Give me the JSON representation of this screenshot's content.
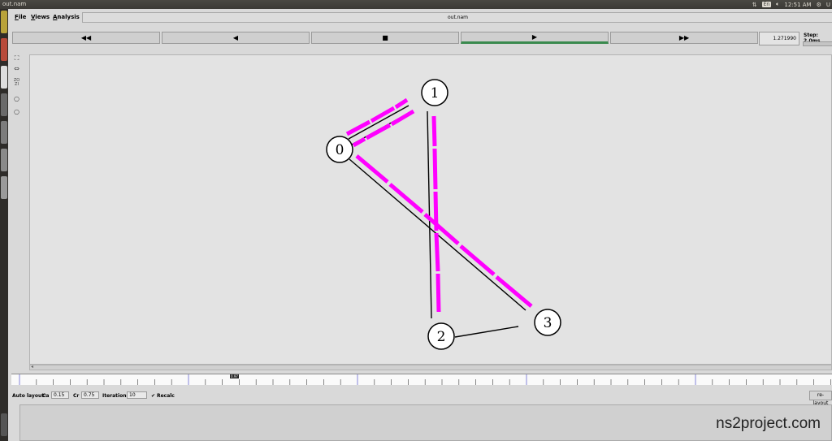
{
  "topbar": {
    "window_title": "out.nam",
    "keyboard": "En",
    "time": "12:51 AM",
    "user": "U"
  },
  "menu": {
    "file": "File",
    "views": "Views",
    "analysis": "Analysis"
  },
  "filename": "out.nam",
  "controls": {
    "rewind": "◀◀",
    "back": "◀",
    "stop": "■",
    "play": "▶",
    "fast_forward": "▶▶",
    "time": "1.271990",
    "step": "Step: 2.0ms"
  },
  "tools": {
    "zoom_in": "ZO",
    "zoom_out": "ZI"
  },
  "network": {
    "nodes": [
      {
        "id": "0",
        "label": "0"
      },
      {
        "id": "1",
        "label": "1"
      },
      {
        "id": "2",
        "label": "2"
      },
      {
        "id": "3",
        "label": "3"
      }
    ],
    "links": [
      {
        "from": "0",
        "to": "1"
      },
      {
        "from": "1",
        "to": "2"
      },
      {
        "from": "0",
        "to": "3"
      },
      {
        "from": "2",
        "to": "3"
      }
    ],
    "packet_color": "#ff00ff",
    "link_color": "#000000"
  },
  "timeline": {
    "marker": "0.97"
  },
  "autolayout": {
    "label": "Auto layout:",
    "ca_label": "Ca",
    "ca_value": "0.15",
    "cr_label": "Cr",
    "cr_value": "0.75",
    "iterations_label": "Iterations",
    "iterations_value": "10",
    "recalc_label": "Recalc",
    "relayout_label": "re-layout"
  },
  "watermark": "ns2project.com"
}
